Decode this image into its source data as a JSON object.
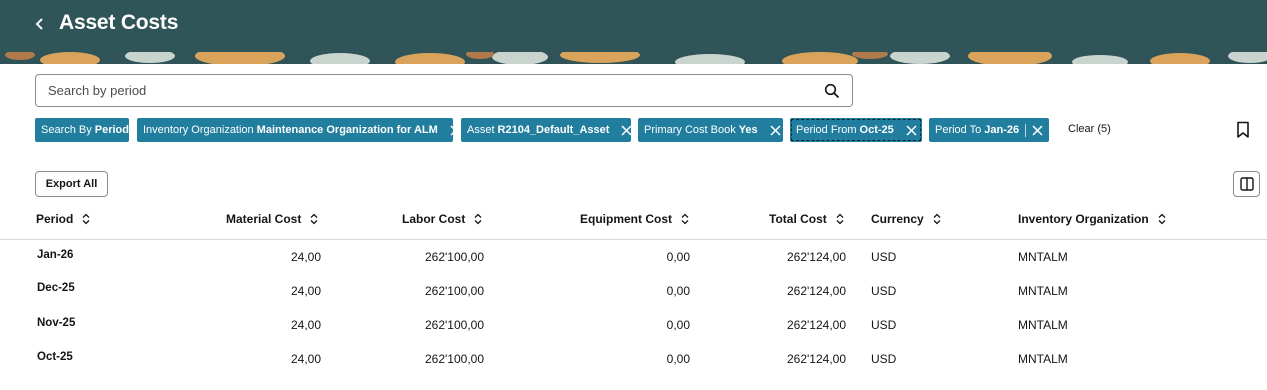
{
  "header": {
    "title": "Asset Costs",
    "back_icon": "chevron-left-icon"
  },
  "search": {
    "placeholder": "Search by period",
    "value": ""
  },
  "filters": {
    "search_by": {
      "label": "Search By",
      "value": "Period"
    },
    "chips": [
      {
        "label": "Inventory Organization",
        "value": "Maintenance Organization for ALM"
      },
      {
        "label": "Asset",
        "value": "R2104_Default_Asset"
      },
      {
        "label": "Primary Cost Book",
        "value": "Yes"
      },
      {
        "label": "Period From",
        "value": "Oct-25"
      },
      {
        "label": "Period To",
        "value": "Jan-26"
      }
    ],
    "clear_label": "Clear (5)"
  },
  "toolbar": {
    "export_label": "Export All"
  },
  "table": {
    "columns": [
      "Period",
      "Material Cost",
      "Labor Cost",
      "Equipment Cost",
      "Total Cost",
      "Currency",
      "Inventory Organization"
    ],
    "rows": [
      [
        "Jan-26",
        "24,00",
        "262'100,00",
        "0,00",
        "262'124,00",
        "USD",
        "MNTALM"
      ],
      [
        "Dec-25",
        "24,00",
        "262'100,00",
        "0,00",
        "262'124,00",
        "USD",
        "MNTALM"
      ],
      [
        "Nov-25",
        "24,00",
        "262'100,00",
        "0,00",
        "262'124,00",
        "USD",
        "MNTALM"
      ],
      [
        "Oct-25",
        "24,00",
        "262'100,00",
        "0,00",
        "262'124,00",
        "USD",
        "MNTALM"
      ]
    ]
  },
  "colors": {
    "header_bg": "#305558",
    "chip_bg": "#227e9e",
    "pattern_colors": [
      "#d9a35c",
      "#c9d4cf",
      "#3f6a6b",
      "#b07a4a"
    ]
  }
}
